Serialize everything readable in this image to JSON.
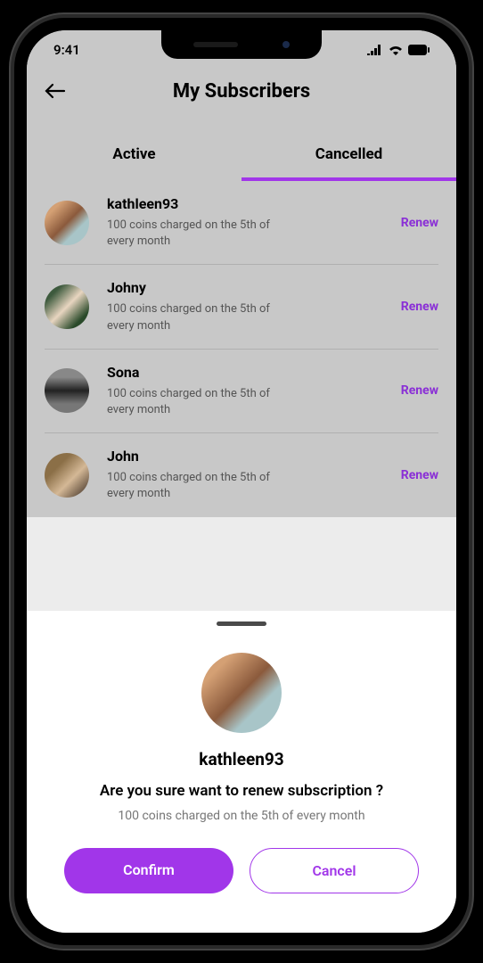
{
  "status": {
    "time": "9:41"
  },
  "header": {
    "title": "My Subscribers"
  },
  "tabs": {
    "active": "Active",
    "cancelled": "Cancelled"
  },
  "subscribers": [
    {
      "name": "kathleen93",
      "desc": "100 coins charged on the 5th of every month",
      "action": "Renew"
    },
    {
      "name": "Johny",
      "desc": "100 coins charged on the 5th of every month",
      "action": "Renew"
    },
    {
      "name": "Sona",
      "desc": "100 coins charged on the 5th of every month",
      "action": "Renew"
    },
    {
      "name": "John",
      "desc": "100 coins charged on the 5th of every month",
      "action": "Renew"
    }
  ],
  "sheet": {
    "name": "kathleen93",
    "question": "Are you sure want to renew subscription ?",
    "desc": "100 coins charged on the 5th of every month",
    "confirm": "Confirm",
    "cancel": "Cancel"
  }
}
